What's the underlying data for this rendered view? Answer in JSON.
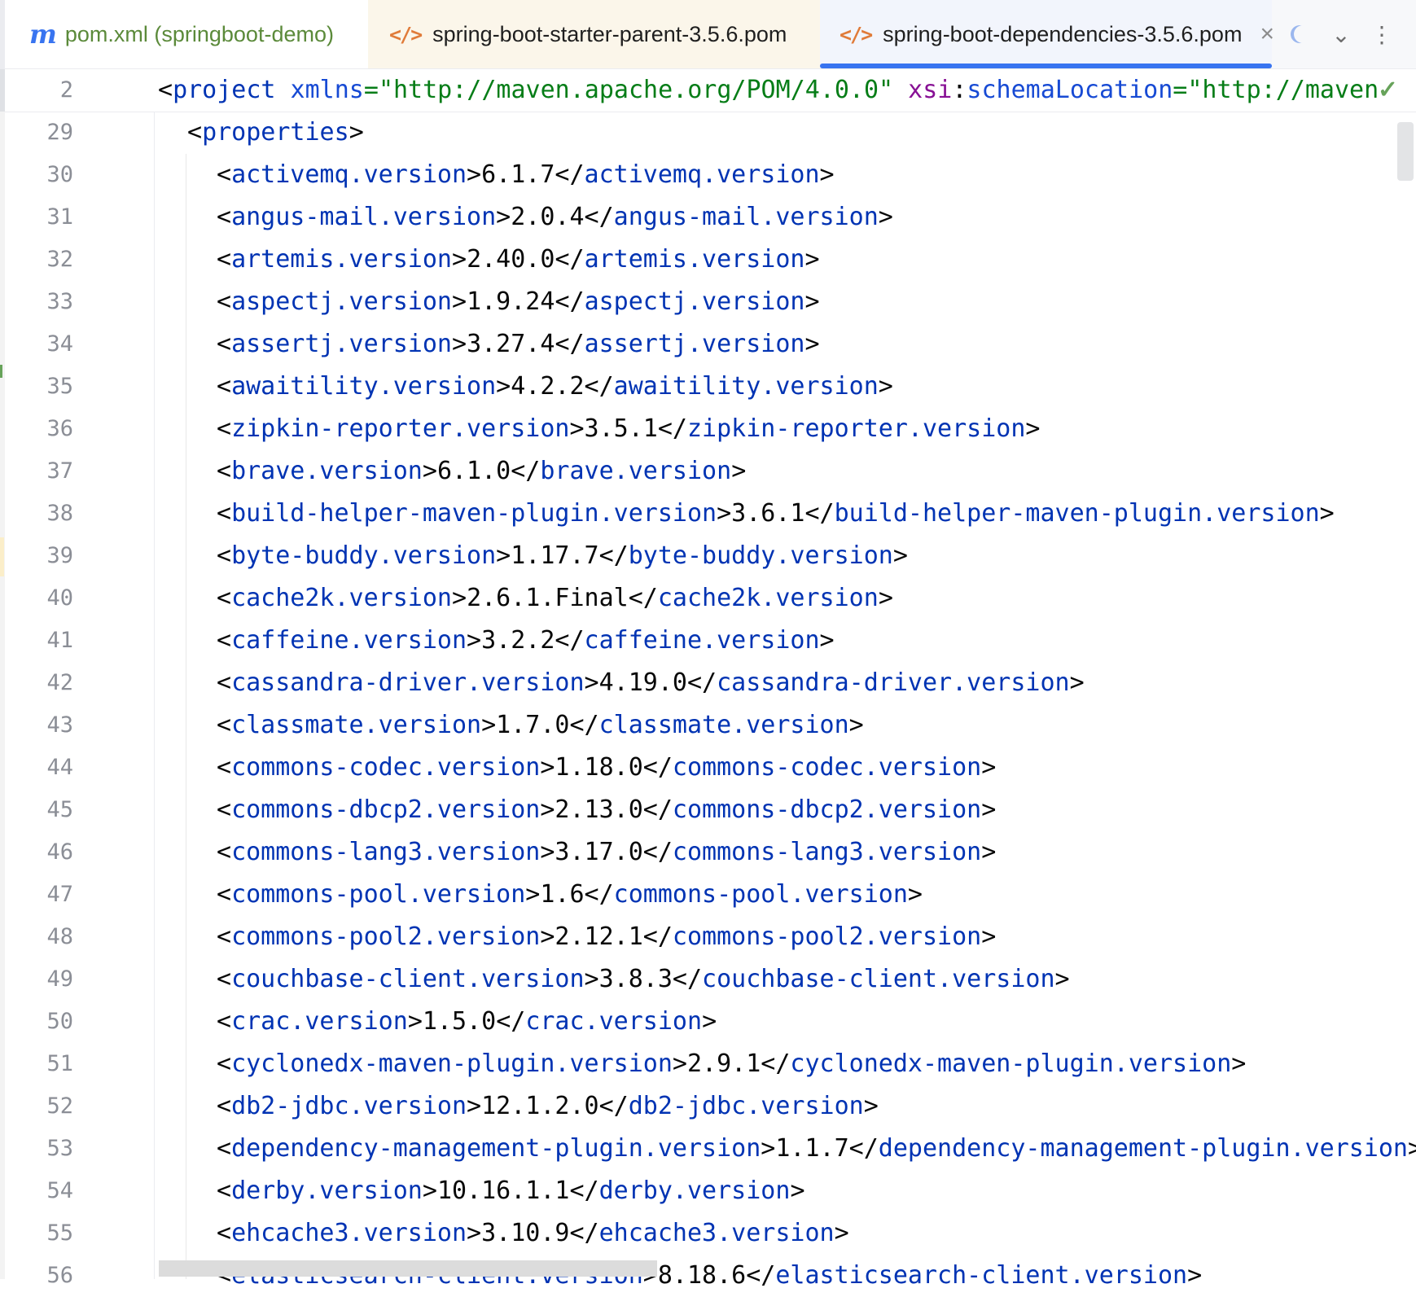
{
  "tabs": [
    {
      "label": "pom.xml (springboot-demo)",
      "icon": "maven-m-icon"
    },
    {
      "label": "spring-boot-starter-parent-3.5.6.pom",
      "icon": "xml-code-icon"
    },
    {
      "label": "spring-boot-dependencies-3.5.6.pom",
      "icon": "xml-code-icon",
      "active": true
    }
  ],
  "tab_icons": {
    "maven": "m",
    "code": "</>",
    "close": "×",
    "dropdown": "⌄",
    "more": "⋮"
  },
  "sticky": {
    "line_number": "2",
    "open": "<",
    "tag": "project",
    "attr1": " xmlns",
    "eq": "=",
    "val1": "\"http://maven.apache.org/POM/4.0.0\"",
    "ns": " xsi",
    "colon": ":",
    "attr2": "schemaLocation",
    "val2": "\"http://maven",
    "check": "✓"
  },
  "properties_line": {
    "number": "29",
    "open": "<",
    "tag": "properties",
    "close": ">"
  },
  "lines": [
    {
      "n": "30",
      "tag": "activemq.version",
      "value": "6.1.7"
    },
    {
      "n": "31",
      "tag": "angus-mail.version",
      "value": "2.0.4"
    },
    {
      "n": "32",
      "tag": "artemis.version",
      "value": "2.40.0"
    },
    {
      "n": "33",
      "tag": "aspectj.version",
      "value": "1.9.24"
    },
    {
      "n": "34",
      "tag": "assertj.version",
      "value": "3.27.4"
    },
    {
      "n": "35",
      "tag": "awaitility.version",
      "value": "4.2.2"
    },
    {
      "n": "36",
      "tag": "zipkin-reporter.version",
      "value": "3.5.1"
    },
    {
      "n": "37",
      "tag": "brave.version",
      "value": "6.1.0"
    },
    {
      "n": "38",
      "tag": "build-helper-maven-plugin.version",
      "value": "3.6.1"
    },
    {
      "n": "39",
      "tag": "byte-buddy.version",
      "value": "1.17.7"
    },
    {
      "n": "40",
      "tag": "cache2k.version",
      "value": "2.6.1.Final"
    },
    {
      "n": "41",
      "tag": "caffeine.version",
      "value": "3.2.2"
    },
    {
      "n": "42",
      "tag": "cassandra-driver.version",
      "value": "4.19.0"
    },
    {
      "n": "43",
      "tag": "classmate.version",
      "value": "1.7.0"
    },
    {
      "n": "44",
      "tag": "commons-codec.version",
      "value": "1.18.0"
    },
    {
      "n": "45",
      "tag": "commons-dbcp2.version",
      "value": "2.13.0"
    },
    {
      "n": "46",
      "tag": "commons-lang3.version",
      "value": "3.17.0"
    },
    {
      "n": "47",
      "tag": "commons-pool.version",
      "value": "1.6"
    },
    {
      "n": "48",
      "tag": "commons-pool2.version",
      "value": "2.12.1"
    },
    {
      "n": "49",
      "tag": "couchbase-client.version",
      "value": "3.8.3"
    },
    {
      "n": "50",
      "tag": "crac.version",
      "value": "1.5.0"
    },
    {
      "n": "51",
      "tag": "cyclonedx-maven-plugin.version",
      "value": "2.9.1"
    },
    {
      "n": "52",
      "tag": "db2-jdbc.version",
      "value": "12.1.2.0"
    },
    {
      "n": "53",
      "tag": "dependency-management-plugin.version",
      "value": "1.1.7"
    },
    {
      "n": "54",
      "tag": "derby.version",
      "value": "10.16.1.1"
    },
    {
      "n": "55",
      "tag": "ehcache3.version",
      "value": "3.10.9"
    },
    {
      "n": "56",
      "tag": "elasticsearch-client.version",
      "value": "8.18.6"
    }
  ],
  "colors": {
    "tag": "#0033b3",
    "string": "#067d17",
    "namespace": "#871094",
    "active_tab_underline": "#3874f0"
  }
}
